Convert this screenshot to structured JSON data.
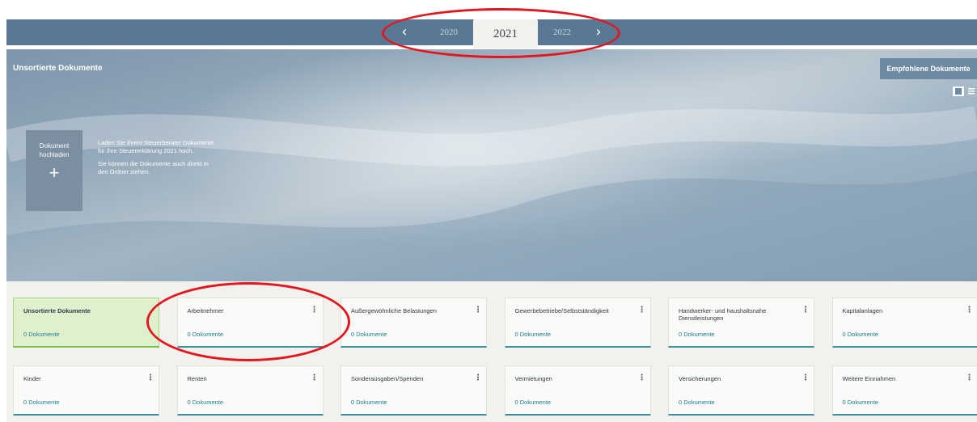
{
  "years": {
    "prev_label": "2020",
    "current_label": "2021",
    "next_label": "2022"
  },
  "hero": {
    "title": "Unsortierte Dokumente",
    "recommended_button": "Empfohlene Dokumente",
    "upload_label": "Dokument hochladen",
    "upload_plus": "+",
    "hint_line1": "Laden Sie Ihrem Steuerberater Dokumente für Ihre Steuererklärung 2021 hoch.",
    "hint_line2": "Sie können die Dokumente auch direkt in den Ordner ziehen."
  },
  "cards": [
    {
      "name": "Unsortierte Dokumente",
      "count": "0 Dokumente",
      "active": true,
      "menu": false
    },
    {
      "name": "Arbeitnehmer",
      "count": "0 Dokumente",
      "active": false,
      "menu": true
    },
    {
      "name": "Außergewöhnliche Belastungen",
      "count": "0 Dokumente",
      "active": false,
      "menu": true
    },
    {
      "name": "Gewerbebetriebe/Selbstständigkeit",
      "count": "0 Dokumente",
      "active": false,
      "menu": true
    },
    {
      "name": "Handwerker- und haushaltsnahe Dienstleistungen",
      "count": "0 Dokumente",
      "active": false,
      "menu": true
    },
    {
      "name": "Kapitalanlagen",
      "count": "0 Dokumente",
      "active": false,
      "menu": true
    },
    {
      "name": "Kinder",
      "count": "0 Dokumente",
      "active": false,
      "menu": true
    },
    {
      "name": "Renten",
      "count": "0 Dokumente",
      "active": false,
      "menu": true
    },
    {
      "name": "Sonderausgaben/Spenden",
      "count": "0 Dokumente",
      "active": false,
      "menu": true
    },
    {
      "name": "Vermietungen",
      "count": "0 Dokumente",
      "active": false,
      "menu": true
    },
    {
      "name": "Versicherungen",
      "count": "0 Dokumente",
      "active": false,
      "menu": true
    },
    {
      "name": "Weitere Einnahmen",
      "count": "0 Dokumente",
      "active": false,
      "menu": true
    }
  ],
  "icons": {
    "prev": "chevron-left-icon",
    "next": "chevron-right-icon",
    "menu": "kebab-menu-icon",
    "tile_view": "tile-view-icon",
    "list_view": "list-view-icon"
  },
  "colors": {
    "header_bar": "#597894",
    "card_accent": "#3a8f9a",
    "active_card": "#dff0cf",
    "annotation": "#e3161e"
  }
}
